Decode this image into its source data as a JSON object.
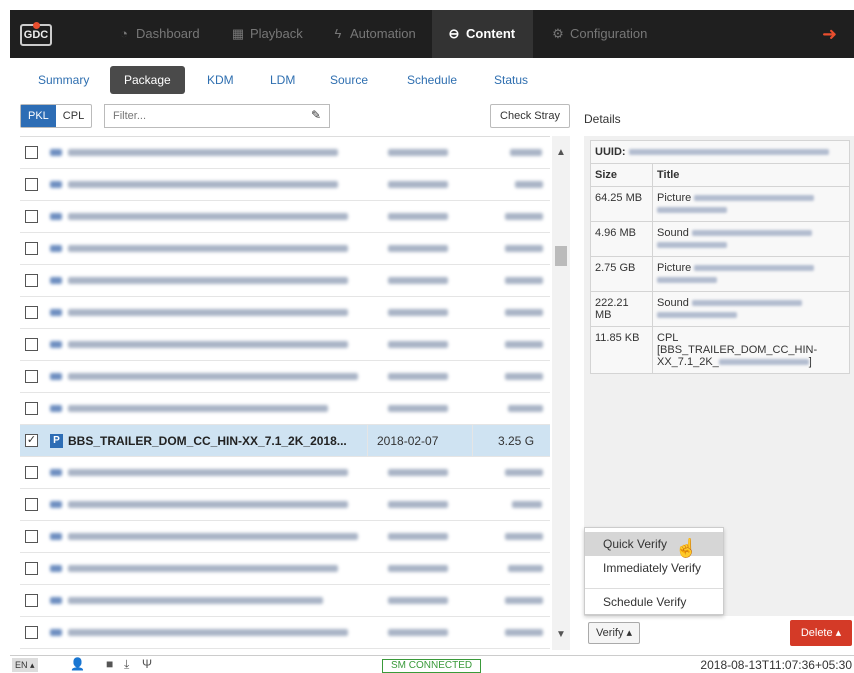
{
  "topnav": {
    "logo": "GDC",
    "items": [
      {
        "label": "Dashboard",
        "icon": "dashboard-icon"
      },
      {
        "label": "Playback",
        "icon": "film-icon"
      },
      {
        "label": "Automation",
        "icon": "bolt-icon"
      },
      {
        "label": "Content",
        "icon": "drive-icon",
        "active": true
      },
      {
        "label": "Configuration",
        "icon": "gears-icon"
      }
    ],
    "logout_icon": "sign-out-icon"
  },
  "tabs": [
    "Summary",
    "Package",
    "KDM",
    "LDM",
    "Source",
    "Schedule",
    "Status"
  ],
  "active_tab": "Package",
  "filter": {
    "segments": [
      "PKL",
      "CPL"
    ],
    "active_segment": "PKL",
    "placeholder": "Filter...",
    "clear_icon": "eraser-icon",
    "check_stray_label": "Check Stray"
  },
  "package_list": {
    "selected_row": {
      "badge": "P",
      "title": "BBS_TRAILER_DOM_CC_HIN-XX_7.1_2K_2018...",
      "date": "2018-02-07",
      "size": "3.25 G",
      "checked": true
    }
  },
  "details": {
    "label": "Details",
    "uuid_label": "UUID:",
    "headers": {
      "size": "Size",
      "title": "Title"
    },
    "rows": [
      {
        "size": "64.25 MB",
        "type": "Picture"
      },
      {
        "size": "4.96 MB",
        "type": "Sound"
      },
      {
        "size": "2.75 GB",
        "type": "Picture"
      },
      {
        "size": "222.21 MB",
        "type": "Sound"
      },
      {
        "size": "11.85 KB",
        "type": "CPL",
        "title_line1": "[BBS_TRAILER_DOM_CC_HIN-",
        "title_line2": "XX_7.1_2K_",
        "title_end": "]"
      }
    ]
  },
  "verify_menu": {
    "items": [
      "Quick Verify",
      "Immediately Verify",
      "Schedule Verify"
    ],
    "hovered": "Quick Verify"
  },
  "buttons": {
    "verify": "Verify ▴",
    "delete": "Delete ▴"
  },
  "footer": {
    "language": "EN ▴",
    "status": "SM CONNECTED",
    "timestamp": "2018-08-13T11:07:36+05:30"
  },
  "colors": {
    "accent_blue": "#2d6db5",
    "delete_red": "#d43a27",
    "connected_green": "#3a9a3a",
    "nav_bg": "#1f1f1f"
  }
}
